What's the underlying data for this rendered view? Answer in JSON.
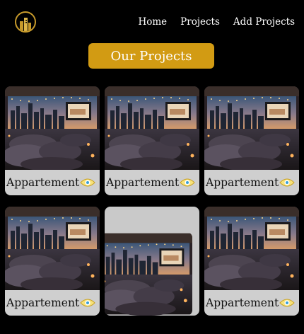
{
  "header": {
    "logo_icon": "building-logo-icon",
    "nav": [
      {
        "label": "Home"
      },
      {
        "label": "Projects"
      },
      {
        "label": "Add Projects"
      }
    ]
  },
  "main": {
    "title": "Our Projects",
    "projects": [
      {
        "name": "Appartement",
        "action_icon": "eye-icon"
      },
      {
        "name": "Appartement",
        "action_icon": "eye-icon"
      },
      {
        "name": "Appartement",
        "action_icon": "eye-icon"
      },
      {
        "name": "Appartement",
        "action_icon": "eye-icon"
      },
      {
        "name": "",
        "action_icon": ""
      },
      {
        "name": "Appartement",
        "action_icon": "eye-icon"
      }
    ]
  },
  "colors": {
    "accent": "#d29b13",
    "card_bg": "#cfcfcf",
    "background": "#000000"
  }
}
